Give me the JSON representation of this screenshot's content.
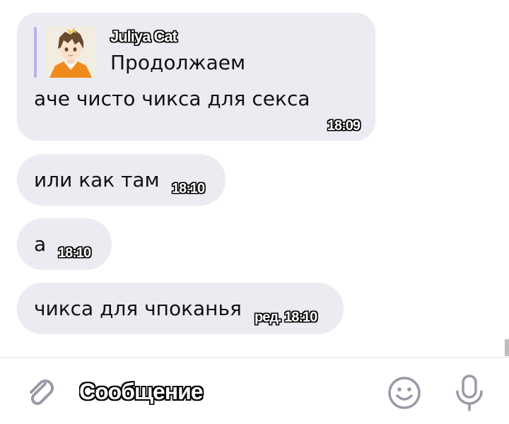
{
  "messages": [
    {
      "reply": {
        "author": "Juliya Cat",
        "text": "Продолжаем"
      },
      "text": "аче чисто чикса для секса",
      "time": "18:09"
    },
    {
      "text": "или как там",
      "time": "18:10"
    },
    {
      "text": "а",
      "time": "18:10"
    },
    {
      "text": "чикса для чпоканья",
      "time": "ред. 18:10"
    }
  ],
  "composer": {
    "placeholder": "Сообщение",
    "icons": {
      "attach": "paperclip-icon",
      "emoji": "smiley-icon",
      "voice": "microphone-icon"
    }
  },
  "colors": {
    "bubble_bg": "#ebebf1",
    "reply_bar": "#b9b2ee",
    "icon_gray": "#9a9aa6"
  }
}
